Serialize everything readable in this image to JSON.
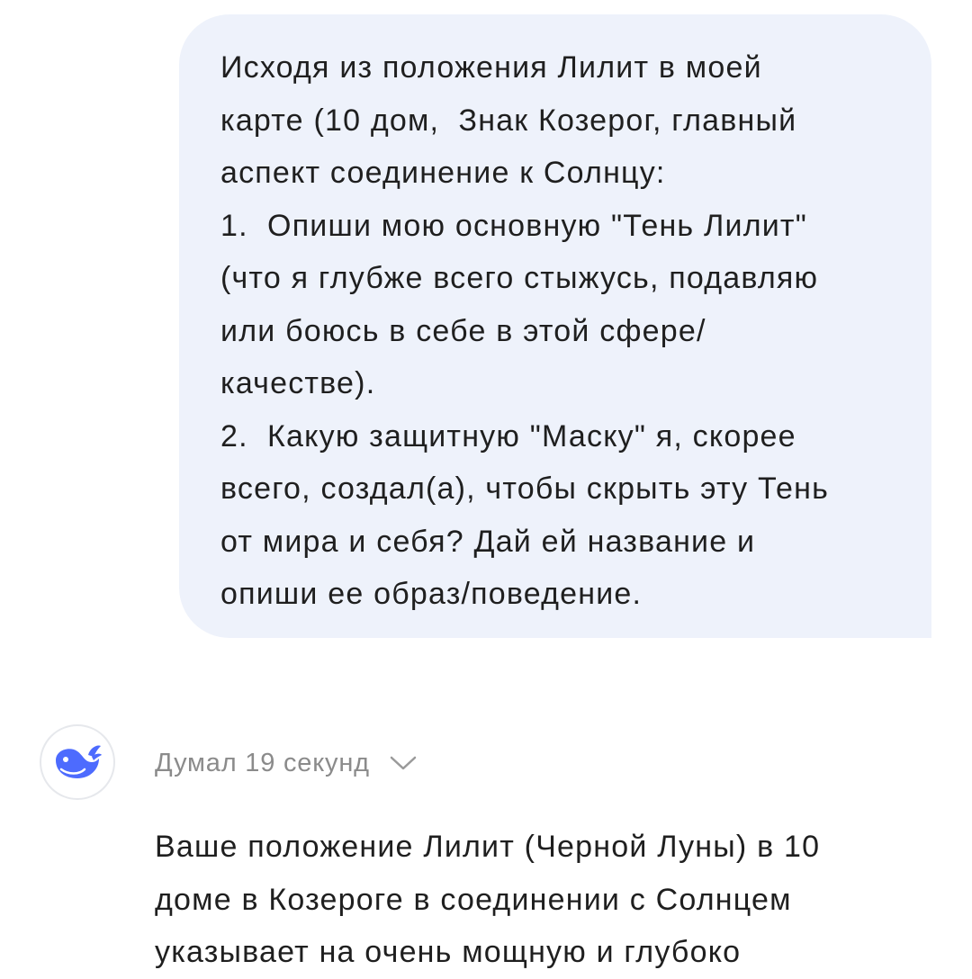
{
  "user_message": {
    "lines": [
      "Исходя из положения Лилит в моей",
      "карте (10 дом,  Знак Козерог, главный",
      "аспект соединение к Солнцу:",
      "1.  Опиши мою основную \"Тень Лилит\"",
      "(что я глубже всего стыжусь, подавляю",
      "или боюсь в себе в этой сфере/",
      "качестве).",
      "2.  Какую защитную \"Маску\" я, скорее",
      "всего, создал(а), чтобы скрыть эту Тень",
      "от мира и себя? Дай ей название и",
      "опиши ее образ/поведение."
    ]
  },
  "assistant": {
    "avatar_icon": "deepseek-whale-icon",
    "accent_color": "#4d6bfe",
    "thinking_label": "Думал 19 секунд",
    "thinking_toggle_icon": "chevron-down-icon",
    "answer_lines": [
      "Ваше положение Лилит (Черной Луны) в 10",
      "доме в Козероге в соединении с Солнцем",
      "указывает на очень мощную и глубоко"
    ]
  }
}
